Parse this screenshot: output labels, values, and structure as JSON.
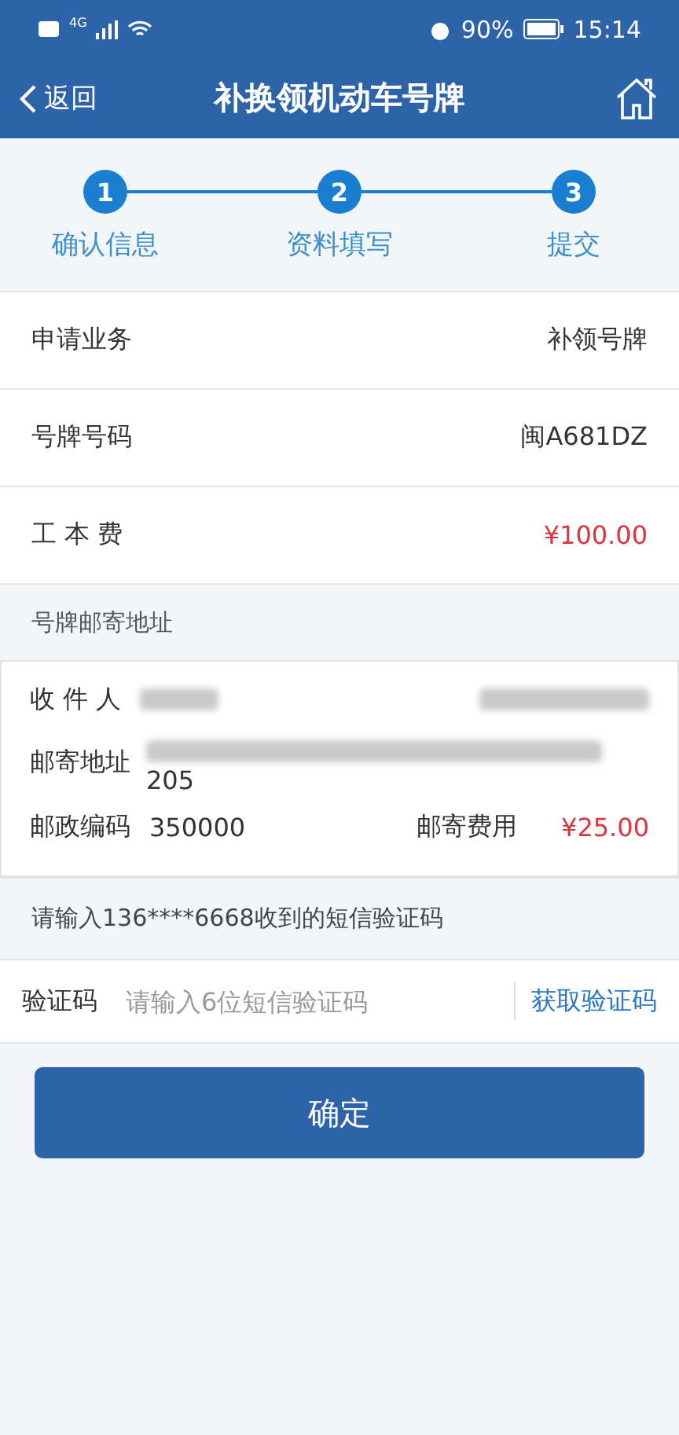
{
  "status_bar": {
    "network": "4G",
    "battery": "90%",
    "time": "15:14"
  },
  "nav": {
    "back": "返回",
    "title": "补换领机动车号牌"
  },
  "steps": [
    {
      "number": "1",
      "label": "确认信息"
    },
    {
      "number": "2",
      "label": "资料填写"
    },
    {
      "number": "3",
      "label": "提交"
    }
  ],
  "info_rows": [
    {
      "label": "申请业务",
      "value": "补领号牌",
      "kind": "plain"
    },
    {
      "label": "号牌号码",
      "value": "闽A681DZ",
      "kind": "plain"
    },
    {
      "label": "工 本 费",
      "value": "¥100.00",
      "kind": "price"
    }
  ],
  "address_section": {
    "title": "号牌邮寄地址",
    "recipient_label": "收 件 人",
    "address_label": "邮寄地址",
    "address_tail": "205",
    "postcode_label": "邮政编码",
    "postcode": "350000",
    "fee_label": "邮寄费用",
    "fee": "¥25.00"
  },
  "sms_hint": "请输入136****6668收到的短信验证码",
  "verify": {
    "label": "验证码",
    "placeholder": "请输入6位短信验证码",
    "get_code": "获取验证码"
  },
  "submit": "确定"
}
